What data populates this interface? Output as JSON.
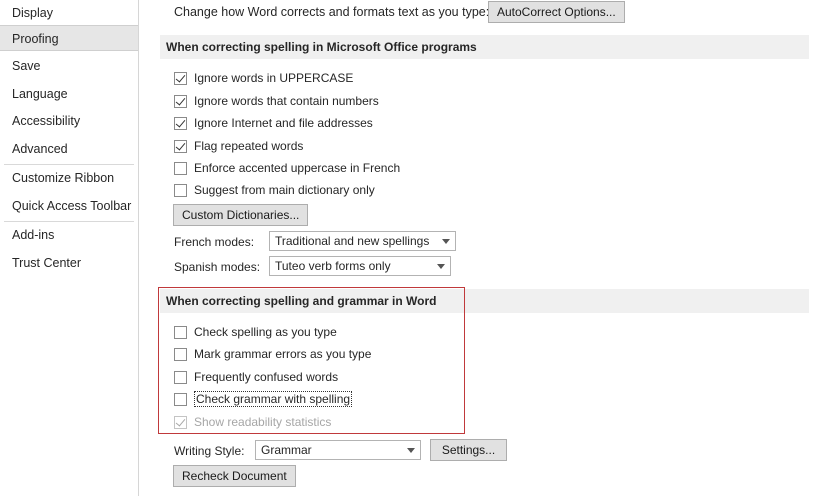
{
  "sidebar": {
    "items": [
      {
        "label": "Display"
      },
      {
        "label": "Proofing",
        "selected": true
      },
      {
        "label": "Save"
      },
      {
        "label": "Language"
      },
      {
        "label": "Accessibility"
      },
      {
        "label": "Advanced"
      },
      {
        "label": "Customize Ribbon"
      },
      {
        "label": "Quick Access Toolbar"
      },
      {
        "label": "Add-ins"
      },
      {
        "label": "Trust Center"
      }
    ]
  },
  "autocorrect": {
    "intro": "Change how Word corrects and formats text as you type:",
    "button": "AutoCorrect Options..."
  },
  "office_section": {
    "title": "When correcting spelling in Microsoft Office programs",
    "options": [
      {
        "label": "Ignore words in UPPERCASE",
        "checked": true
      },
      {
        "label": "Ignore words that contain numbers",
        "checked": true
      },
      {
        "label": "Ignore Internet and file addresses",
        "checked": true
      },
      {
        "label": "Flag repeated words",
        "checked": true
      },
      {
        "label": "Enforce accented uppercase in French",
        "checked": false
      },
      {
        "label": "Suggest from main dictionary only",
        "checked": false
      }
    ],
    "custom_dictionaries_button": "Custom Dictionaries...",
    "french_modes": {
      "label": "French modes:",
      "value": "Traditional and new spellings"
    },
    "spanish_modes": {
      "label": "Spanish modes:",
      "value": "Tuteo verb forms only"
    }
  },
  "word_section": {
    "title": "When correcting spelling and grammar in Word",
    "options": [
      {
        "label": "Check spelling as you type",
        "checked": false
      },
      {
        "label": "Mark grammar errors as you type",
        "checked": false
      },
      {
        "label": "Frequently confused words",
        "checked": false
      },
      {
        "label": "Check grammar with spelling",
        "checked": false
      },
      {
        "label": "Show readability statistics",
        "checked": true,
        "disabled": true
      }
    ],
    "writing_style": {
      "label": "Writing Style:",
      "value": "Grammar"
    },
    "settings_button": "Settings...",
    "recheck_button": "Recheck Document"
  },
  "colors": {
    "highlight_box": "#c0393b",
    "selected_sidebar": "#e6e6e6",
    "section_header_bg": "#f0f0f0"
  }
}
